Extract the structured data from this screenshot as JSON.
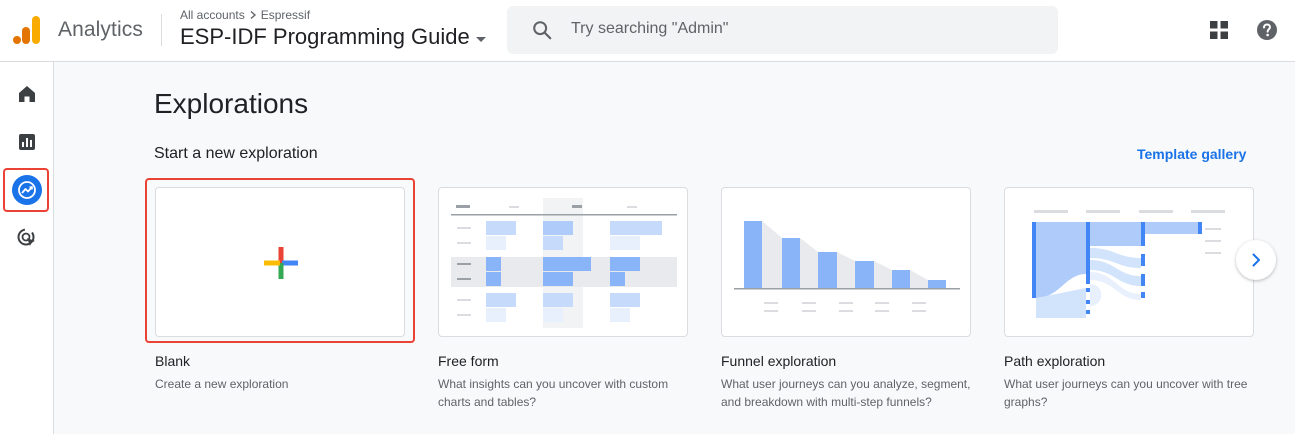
{
  "header": {
    "product_name": "Analytics",
    "breadcrumb": {
      "level1": "All accounts",
      "level2": "Espressif"
    },
    "property_name": "ESP-IDF Programming Guide",
    "search_placeholder": "Try searching \"Admin\"",
    "icons": [
      "analytics-logo",
      "search-icon",
      "apps-grid-icon",
      "help-icon"
    ]
  },
  "sidebar": {
    "items": [
      {
        "name": "Home",
        "icon": "home-icon",
        "active": false
      },
      {
        "name": "Reports",
        "icon": "reports-icon",
        "active": false
      },
      {
        "name": "Explore",
        "icon": "explore-icon",
        "active": true
      },
      {
        "name": "Advertising",
        "icon": "advertising-icon",
        "active": false
      }
    ]
  },
  "main": {
    "page_title": "Explorations",
    "section_title": "Start a new exploration",
    "template_gallery_label": "Template gallery",
    "cards": [
      {
        "title": "Blank",
        "description": "Create a new exploration"
      },
      {
        "title": "Free form",
        "description": "What insights can you uncover with custom charts and tables?"
      },
      {
        "title": "Funnel exploration",
        "description": "What user journeys can you analyze, segment, and breakdown with multi-step funnels?"
      },
      {
        "title": "Path exploration",
        "description": "What user journeys can you uncover with tree graphs?"
      }
    ]
  },
  "colors": {
    "accent": "#1a73e8",
    "highlight": "#ea4335",
    "logo_orange": "#f9ab00",
    "logo_dark_orange": "#e37400"
  }
}
